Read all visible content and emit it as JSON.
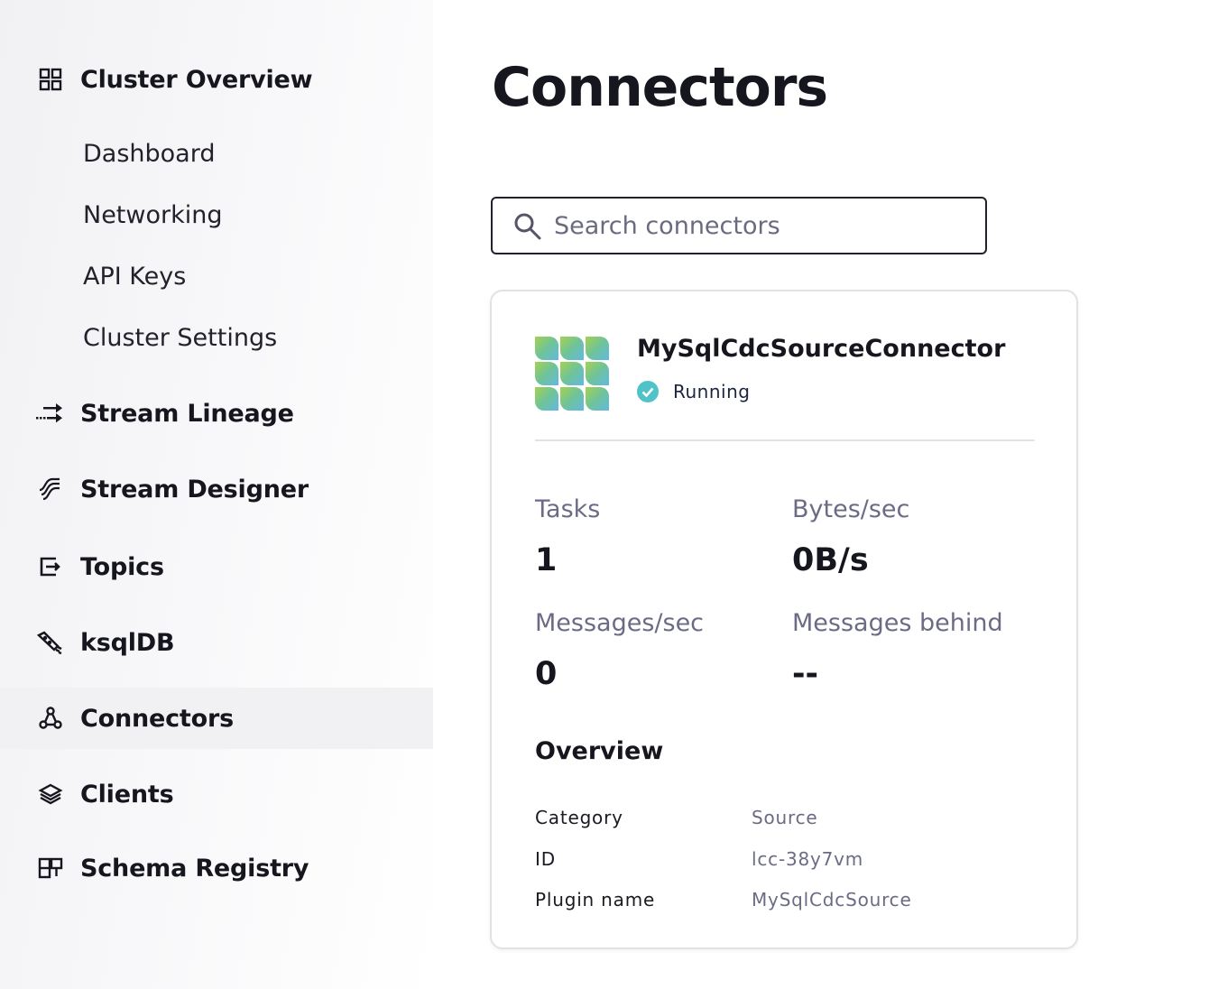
{
  "sidebar": {
    "cluster_overview": "Cluster Overview",
    "sub_items": [
      "Dashboard",
      "Networking",
      "API Keys",
      "Cluster Settings"
    ],
    "items": [
      {
        "label": "Stream Lineage",
        "icon": "stream-lineage-icon"
      },
      {
        "label": "Stream Designer",
        "icon": "stream-designer-icon"
      },
      {
        "label": "Topics",
        "icon": "topics-icon"
      },
      {
        "label": "ksqlDB",
        "icon": "ksqldb-icon"
      },
      {
        "label": "Connectors",
        "icon": "connectors-icon",
        "active": true
      },
      {
        "label": "Clients",
        "icon": "clients-icon"
      },
      {
        "label": "Schema Registry",
        "icon": "schema-registry-icon"
      }
    ]
  },
  "main": {
    "title": "Connectors",
    "search": {
      "placeholder": "Search connectors",
      "value": ""
    },
    "card": {
      "name": "MySqlCdcSourceConnector",
      "status": "Running",
      "status_color": "#4fc3c8",
      "metrics": [
        {
          "label": "Tasks",
          "value": "1"
        },
        {
          "label": "Bytes/sec",
          "value": "0B/s"
        },
        {
          "label": "Messages/sec",
          "value": "0"
        },
        {
          "label": "Messages behind",
          "value": "--"
        }
      ],
      "overview_title": "Overview",
      "overview": [
        {
          "key": "Category",
          "value": "Source"
        },
        {
          "key": "ID",
          "value": "lcc-38y7vm"
        },
        {
          "key": "Plugin name",
          "value": "MySqlCdcSource"
        }
      ]
    }
  }
}
